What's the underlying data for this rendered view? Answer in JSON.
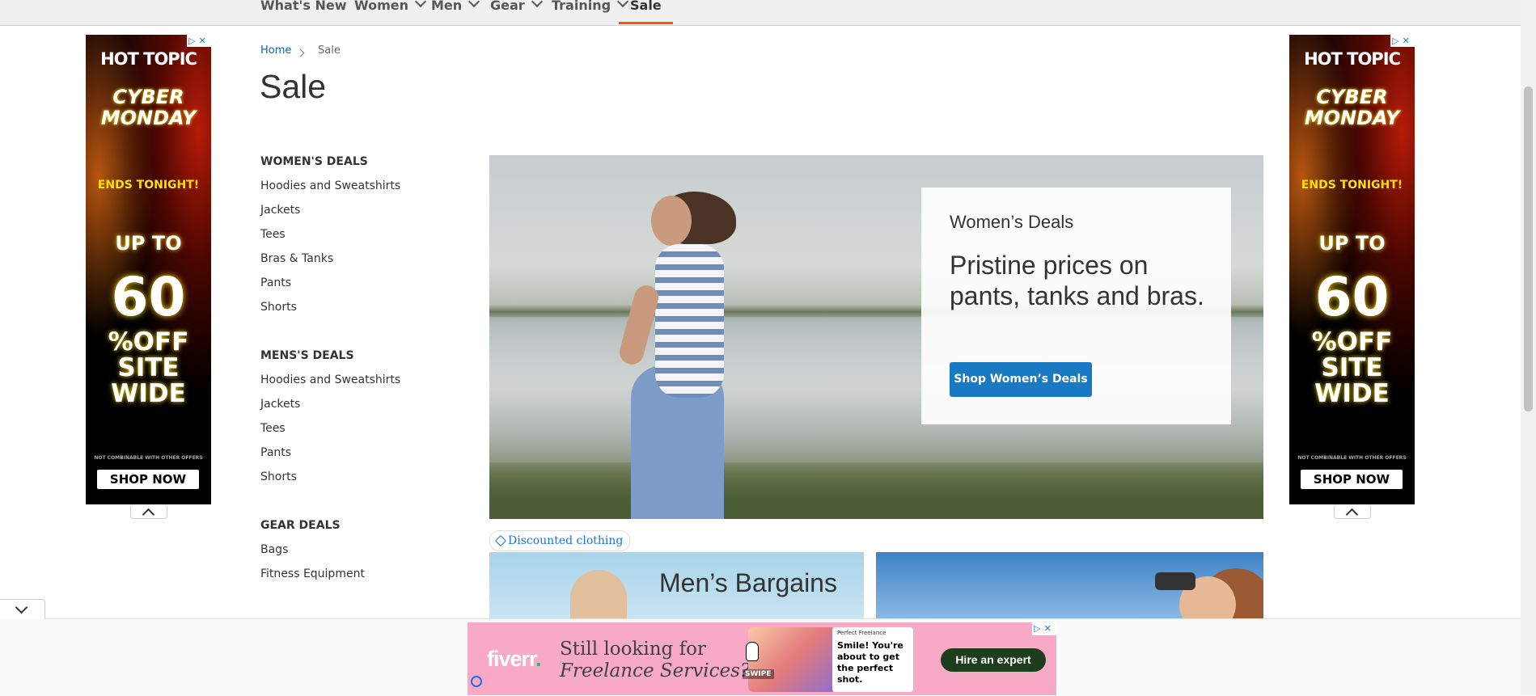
{
  "nav": {
    "items": [
      {
        "label": "What's New",
        "has_dropdown": false
      },
      {
        "label": "Women",
        "has_dropdown": true
      },
      {
        "label": "Men",
        "has_dropdown": true
      },
      {
        "label": "Gear",
        "has_dropdown": true
      },
      {
        "label": "Training",
        "has_dropdown": true
      },
      {
        "label": "Sale",
        "has_dropdown": false,
        "active": true
      }
    ],
    "active_color": "#ff5501"
  },
  "breadcrumb": {
    "home": "Home",
    "current": "Sale"
  },
  "page_title": "Sale",
  "categories": [
    {
      "heading": "WOMEN'S DEALS",
      "links": [
        "Hoodies and Sweatshirts",
        "Jackets",
        "Tees",
        "Bras & Tanks",
        "Pants",
        "Shorts"
      ]
    },
    {
      "heading": "MENS'S DEALS",
      "links": [
        "Hoodies and Sweatshirts",
        "Jackets",
        "Tees",
        "Pants",
        "Shorts"
      ]
    },
    {
      "heading": "GEAR DEALS",
      "links": [
        "Bags",
        "Fitness Equipment"
      ]
    }
  ],
  "hero": {
    "subtitle": "Women’s Deals",
    "headline": "Pristine prices on pants, tanks and bras.",
    "button": "Shop Women’s Deals",
    "button_color": "#1979c3"
  },
  "tag": {
    "label": "Discounted clothing",
    "icon": "tag-icon"
  },
  "tiles": {
    "men_title": "Men’s Bargains"
  },
  "side_ad": {
    "brand": "HOT TOPIC",
    "line1": "CYBER MONDAY",
    "line2": "ENDS TONIGHT!",
    "line3": "UP TO",
    "line4": "60",
    "line5": "%OFF SITE WIDE",
    "fine": "NOT COMBINABLE WITH OTHER OFFERS",
    "cta": "SHOP NOW"
  },
  "bottom_ad": {
    "logo": "fiverr",
    "headline_1": "Still looking for",
    "headline_2": "Freelance Services?",
    "card_small": "Perfect Freelance",
    "card_text": "Smile! You're about to get the perfect shot.",
    "swipe": "SWIPE",
    "cta": "Hire an expert",
    "ad_controls": "▷✕"
  }
}
